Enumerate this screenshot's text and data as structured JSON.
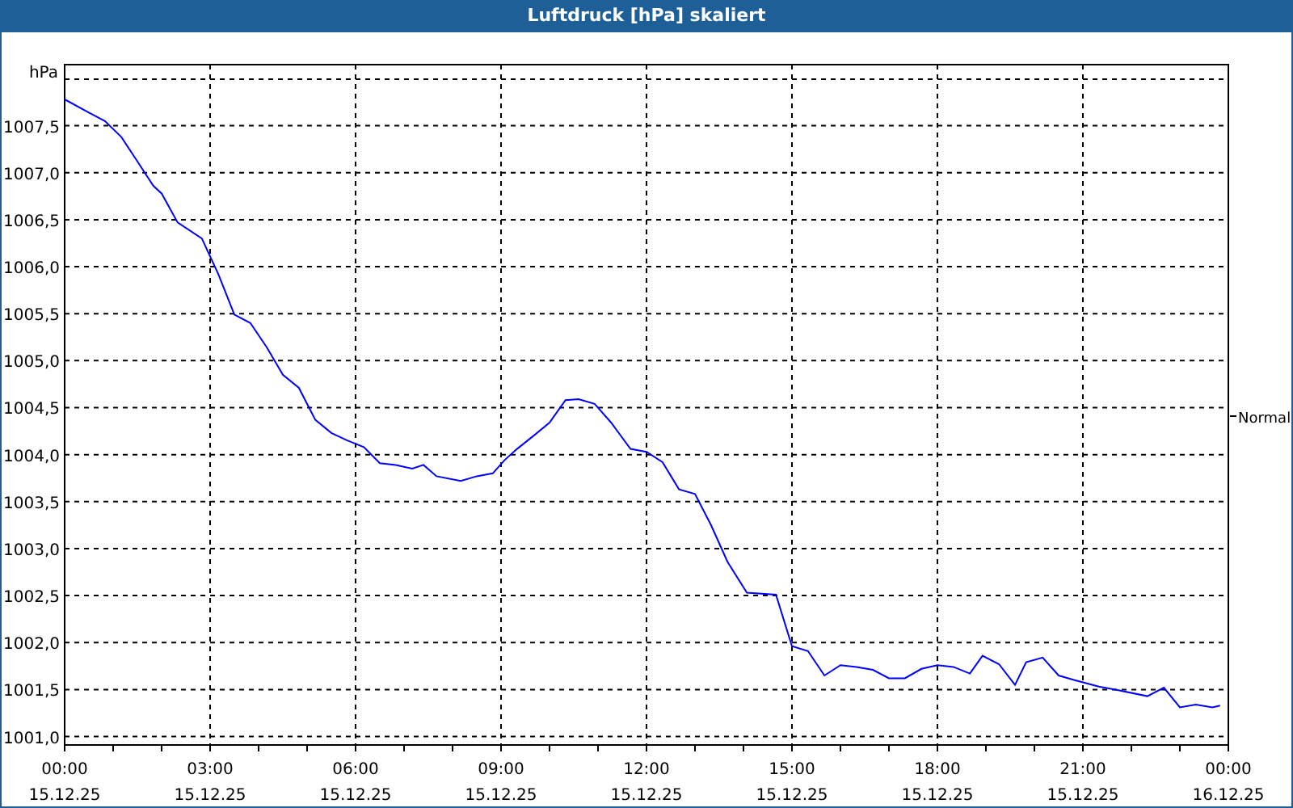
{
  "window": {
    "title": "Luftdruck [hPa] skaliert"
  },
  "chart": {
    "date_labels": [
      "15.12.25",
      "15.12.25",
      "15.12.25",
      "15.12.25",
      "15.12.25",
      "15.12.25",
      "15.12.25",
      "15.12.25",
      "16.12.25"
    ],
    "chart_data": {
      "type": "line",
      "grid": true,
      "ylabel": "hPa",
      "xlim": [
        0,
        24
      ],
      "ylim": [
        1000.91,
        1008.15
      ],
      "xticks": [
        {
          "value": 0,
          "label": "00:00"
        },
        {
          "value": 3,
          "label": "03:00"
        },
        {
          "value": 6,
          "label": "06:00"
        },
        {
          "value": 9,
          "label": "09:00"
        },
        {
          "value": 12,
          "label": "12:00"
        },
        {
          "value": 15,
          "label": "15:00"
        },
        {
          "value": 18,
          "label": "18:00"
        },
        {
          "value": 21,
          "label": "21:00"
        },
        {
          "value": 24,
          "label": "00:00"
        }
      ],
      "yticks": [
        {
          "value": 1001,
          "label": "1001,0"
        },
        {
          "value": 1001.5,
          "label": "1001,5"
        },
        {
          "value": 1002,
          "label": "1002,0"
        },
        {
          "value": 1002.5,
          "label": "1002,5"
        },
        {
          "value": 1003,
          "label": "1003,0"
        },
        {
          "value": 1003.5,
          "label": "1003,5"
        },
        {
          "value": 1004,
          "label": "1004,0"
        },
        {
          "value": 1004.5,
          "label": "1004,5"
        },
        {
          "value": 1005,
          "label": "1005,0"
        },
        {
          "value": 1005.5,
          "label": "1005,5"
        },
        {
          "value": 1006,
          "label": "1006,0"
        },
        {
          "value": 1006.5,
          "label": "1006,5"
        },
        {
          "value": 1007,
          "label": "1007,0"
        },
        {
          "value": 1007.5,
          "label": "1007,5"
        }
      ],
      "x": [
        0,
        0.5,
        0.83,
        1.17,
        1.5,
        1.83,
        2,
        2.33,
        2.83,
        3.17,
        3.5,
        3.83,
        4.17,
        4.5,
        4.83,
        5.17,
        5.5,
        5.83,
        6.17,
        6.5,
        6.83,
        7.17,
        7.4,
        7.67,
        8.17,
        8.5,
        8.83,
        9.07,
        9.33,
        9.67,
        10,
        10.33,
        10.6,
        10.93,
        11.27,
        11.67,
        12,
        12.33,
        12.67,
        13,
        13.33,
        13.67,
        14.07,
        14.67,
        15,
        15.33,
        15.67,
        16,
        16.33,
        16.67,
        17,
        17.33,
        17.67,
        18,
        18.33,
        18.67,
        18.93,
        19.27,
        19.6,
        19.83,
        20.17,
        20.5,
        20.83,
        21.33,
        21.67,
        22.33,
        22.67,
        23,
        23.33,
        23.67,
        23.83
      ],
      "series": [
        {
          "name": "Normal",
          "color": "#0000ff",
          "values": [
            1007.78,
            1007.64,
            1007.55,
            1007.38,
            1007.12,
            1006.86,
            1006.78,
            1006.47,
            1006.3,
            1005.92,
            1005.49,
            1005.4,
            1005.14,
            1004.85,
            1004.71,
            1004.37,
            1004.23,
            1004.15,
            1004.08,
            1003.91,
            1003.89,
            1003.85,
            1003.89,
            1003.77,
            1003.72,
            1003.77,
            1003.8,
            1003.94,
            1004.06,
            1004.2,
            1004.34,
            1004.58,
            1004.59,
            1004.54,
            1004.34,
            1004.06,
            1004.03,
            1003.92,
            1003.63,
            1003.58,
            1003.25,
            1002.86,
            1002.53,
            1002.51,
            1001.96,
            1001.91,
            1001.65,
            1001.76,
            1001.74,
            1001.71,
            1001.62,
            1001.62,
            1001.72,
            1001.76,
            1001.74,
            1001.67,
            1001.86,
            1001.77,
            1001.55,
            1001.79,
            1001.84,
            1001.65,
            1001.6,
            1001.53,
            1001.5,
            1001.43,
            1001.52,
            1001.31,
            1001.34,
            1001.31,
            1001.33
          ]
        }
      ]
    }
  }
}
